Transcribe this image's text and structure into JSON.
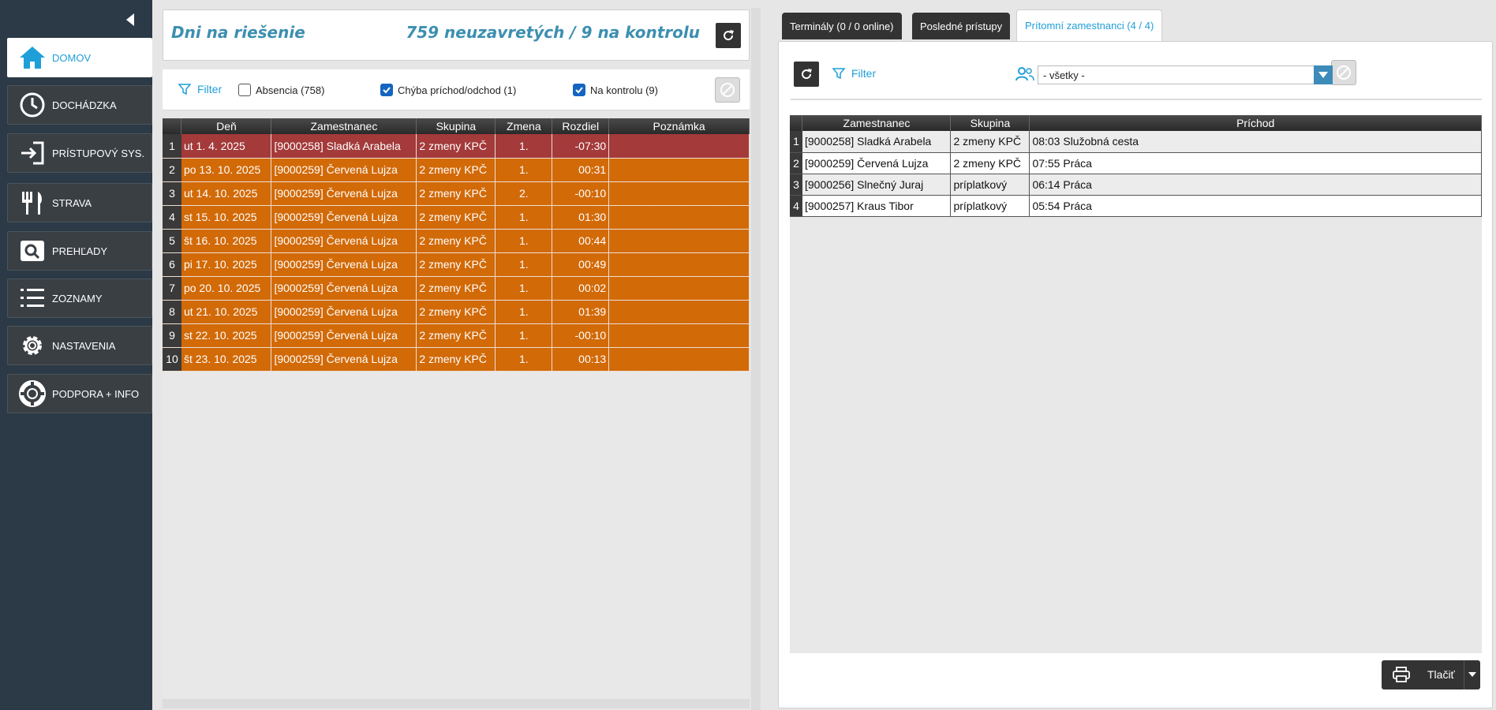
{
  "sidebar": {
    "items": [
      {
        "label": "DOMOV",
        "icon": "home-icon",
        "active": true
      },
      {
        "label": "DOCHÁDZKA",
        "icon": "clock-icon"
      },
      {
        "label": "PRÍSTUPOVÝ SYS.",
        "icon": "login-icon"
      },
      {
        "label": "STRAVA",
        "icon": "fork-knife-icon"
      },
      {
        "label": "PREHĽADY",
        "icon": "search-icon"
      },
      {
        "label": "ZOZNAMY",
        "icon": "list-icon"
      },
      {
        "label": "NASTAVENIA",
        "icon": "gear-icon"
      },
      {
        "label": "PODPORA + INFO",
        "icon": "lifebuoy-icon"
      }
    ]
  },
  "left": {
    "title": "Dni na riešenie",
    "summary": "759 neuzavretých / 9 na kontrolu",
    "filter_label": "Filter",
    "checks": [
      {
        "label": "Absencia (758)",
        "checked": false
      },
      {
        "label": "Chýba príchod/odchod (1)",
        "checked": true
      },
      {
        "label": "Na kontrolu (9)",
        "checked": true
      }
    ],
    "columns": [
      "Deň",
      "Zamestnanec",
      "Skupina",
      "Zmena",
      "Rozdiel",
      "Poznámka"
    ],
    "rows": [
      {
        "n": "1",
        "den": "ut 1. 4. 2025",
        "emp": "[9000258] Sladká Arabela",
        "grp": "2 zmeny KPČ",
        "zm": "1.",
        "roz": "-07:30",
        "pozn": "",
        "color": "red"
      },
      {
        "n": "2",
        "den": "po 13. 10. 2025",
        "emp": "[9000259] Červená Lujza",
        "grp": "2 zmeny KPČ",
        "zm": "1.",
        "roz": "00:31",
        "pozn": "",
        "color": "orange"
      },
      {
        "n": "3",
        "den": "ut 14. 10. 2025",
        "emp": "[9000259] Červená Lujza",
        "grp": "2 zmeny KPČ",
        "zm": "2.",
        "roz": "-00:10",
        "pozn": "",
        "color": "orange"
      },
      {
        "n": "4",
        "den": "st 15. 10. 2025",
        "emp": "[9000259] Červená Lujza",
        "grp": "2 zmeny KPČ",
        "zm": "1.",
        "roz": "01:30",
        "pozn": "",
        "color": "orange"
      },
      {
        "n": "5",
        "den": "št 16. 10. 2025",
        "emp": "[9000259] Červená Lujza",
        "grp": "2 zmeny KPČ",
        "zm": "1.",
        "roz": "00:44",
        "pozn": "",
        "color": "orange"
      },
      {
        "n": "6",
        "den": "pi 17. 10. 2025",
        "emp": "[9000259] Červená Lujza",
        "grp": "2 zmeny KPČ",
        "zm": "1.",
        "roz": "00:49",
        "pozn": "",
        "color": "orange"
      },
      {
        "n": "7",
        "den": "po 20. 10. 2025",
        "emp": "[9000259] Červená Lujza",
        "grp": "2 zmeny KPČ",
        "zm": "1.",
        "roz": "00:02",
        "pozn": "",
        "color": "orange"
      },
      {
        "n": "8",
        "den": "ut 21. 10. 2025",
        "emp": "[9000259] Červená Lujza",
        "grp": "2 zmeny KPČ",
        "zm": "1.",
        "roz": "01:39",
        "pozn": "",
        "color": "orange"
      },
      {
        "n": "9",
        "den": "st 22. 10. 2025",
        "emp": "[9000259] Červená Lujza",
        "grp": "2 zmeny KPČ",
        "zm": "1.",
        "roz": "-00:10",
        "pozn": "",
        "color": "orange"
      },
      {
        "n": "10",
        "den": "št 23. 10. 2025",
        "emp": "[9000259] Červená Lujza",
        "grp": "2 zmeny KPČ",
        "zm": "1.",
        "roz": "00:13",
        "pozn": "",
        "color": "orange"
      }
    ]
  },
  "right": {
    "tabs": [
      {
        "label": "Terminály (0 / 0 online)",
        "active": false
      },
      {
        "label": "Posledné prístupy",
        "active": false
      },
      {
        "label": "Prítomní zamestnanci (4 / 4)",
        "active": true
      }
    ],
    "filter_label": "Filter",
    "select_value": "- všetky -",
    "columns": [
      "Zamestnanec",
      "Skupina",
      "Príchod"
    ],
    "rows": [
      {
        "n": "1",
        "emp": "[9000258] Sladká Arabela",
        "grp": "2 zmeny KPČ",
        "pr": "08:03 Služobná cesta"
      },
      {
        "n": "2",
        "emp": "[9000259] Červená Lujza",
        "grp": "2 zmeny KPČ",
        "pr": "07:55 Práca"
      },
      {
        "n": "3",
        "emp": "[9000256] Slnečný Juraj",
        "grp": "príplatkový",
        "pr": "06:14 Práca"
      },
      {
        "n": "4",
        "emp": "[9000257] Kraus Tibor",
        "grp": "príplatkový",
        "pr": "05:54 Práca"
      }
    ],
    "print_label": "Tlačiť"
  },
  "colors": {
    "sidebar_bg": "#2b3a46",
    "accent": "#1f9fd8",
    "row_orange": "#d26a08",
    "row_red": "#a43a3a",
    "title_text": "#3c8fb0"
  }
}
